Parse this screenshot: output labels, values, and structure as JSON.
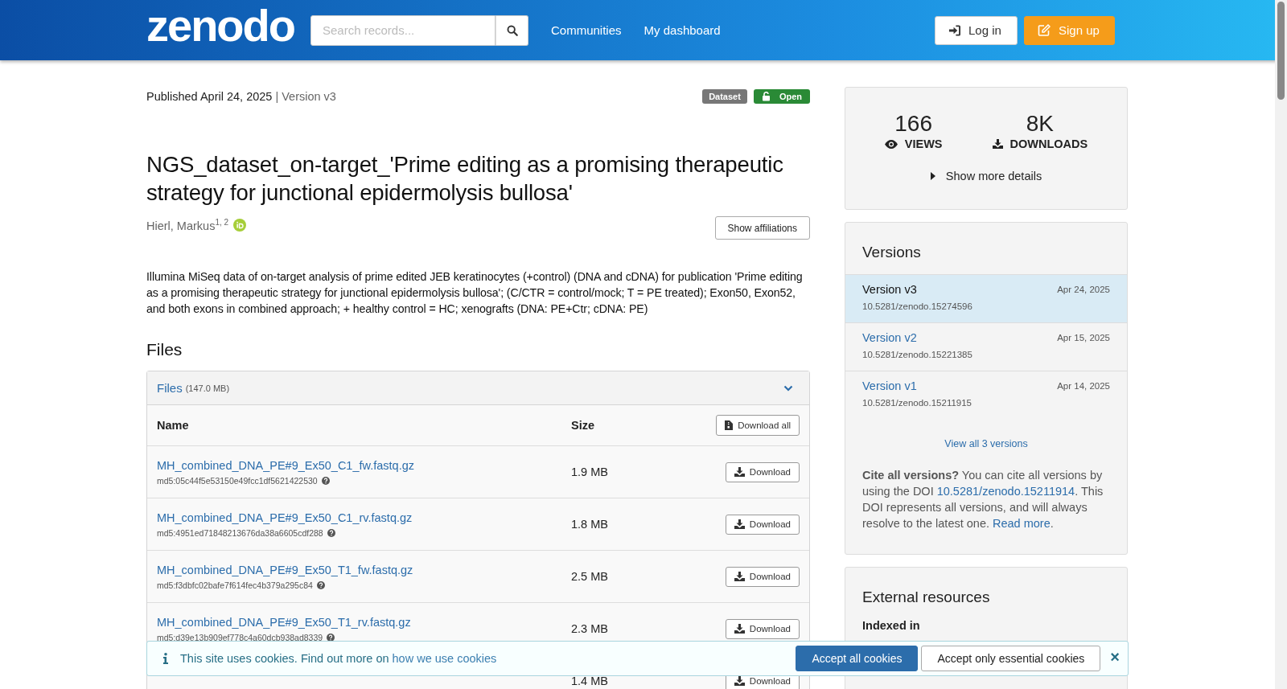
{
  "header": {
    "logo": "zenodo",
    "search": {
      "placeholder": "Search records..."
    },
    "nav": [
      "Communities",
      "My dashboard"
    ],
    "login": "Log in",
    "signup": "Sign up"
  },
  "record": {
    "published": "Published April 24, 2025",
    "version": "| Version v3",
    "badges": [
      {
        "label": "Dataset",
        "kind": "type"
      },
      {
        "label": "Open",
        "kind": "access"
      }
    ],
    "title": "NGS_dataset_on-target_'Prime editing as a promising therapeutic strategy for junctional epidermolysis bullosa'",
    "author": "Hierl, Markus$^{1, 2}$",
    "affiliations_button": "Show affiliations",
    "description": "Illumina MiSeq data of on-target analysis of prime edited JEB keratinocytes (+control) (DNA and cDNA) for publication 'Prime editing as a promising therapeutic strategy for junctional epidermolysis bullosa'; (C/CTR = control/mock; T = PE treated); Exon50, Exon52, and both exons in combined approach; + healthy control = HC; xenografts (DNA: PE+Ctr; cDNA: PE)",
    "files_heading": "Files",
    "files": {
      "title": "Files",
      "total": "(147.0 MB)",
      "expanded": true,
      "columns": [
        "Name",
        "Size"
      ],
      "download_all": "Download all",
      "rows": [
        {
          "name": "MH_combined_DNA_PE#9_Ex50_C1_fw.fastq.gz",
          "md5": "md5:05c44f5e53150e49fcc1df5621422530",
          "size": "1.9 MB",
          "button": "Download"
        },
        {
          "name": "MH_combined_DNA_PE#9_Ex50_C1_rv.fastq.gz",
          "md5": "md5:4951ed71848213676da38a6605cdf288",
          "size": "1.8 MB",
          "button": "Download"
        },
        {
          "name": "MH_combined_DNA_PE#9_Ex50_T1_fw.fastq.gz",
          "md5": "md5:f3dbfc02bafe7f614fec4b379a295c84",
          "size": "2.5 MB",
          "button": "Download"
        },
        {
          "name": "MH_combined_DNA_PE#9_Ex50_T1_rv.fastq.gz",
          "md5": "md5:d39e13b909ef778c4a60dcb938ad8339",
          "size": "2.3 MB",
          "button": "Download"
        },
        {
          "size": "1.4 MB",
          "button": "Download"
        }
      ]
    }
  },
  "sidebar": {
    "stats": [
      {
        "value": "166",
        "label": "VIEWS",
        "kind": "views"
      },
      {
        "value": "8K",
        "label": "DOWNLOADS",
        "kind": "downloads"
      }
    ],
    "more_details": "Show more details",
    "versions": {
      "heading": "Versions",
      "items": [
        {
          "label": "Version v3",
          "date": "Apr 24, 2025",
          "doi": "10.5281/zenodo.15274596",
          "selected": true
        },
        {
          "label": "Version v2",
          "date": "Apr 15, 2025",
          "doi": "10.5281/zenodo.15221385",
          "selected": false
        },
        {
          "label": "Version v1",
          "date": "Apr 14, 2025",
          "doi": "10.5281/zenodo.15211915",
          "selected": false
        }
      ],
      "view_all": "View all 3 versions",
      "cite": {
        "lead": "Cite all versions?",
        "text1": " You can cite all versions by using the DOI ",
        "doi": "10.5281/zenodo.15211914",
        "text2": ". This DOI represents all versions, and will always resolve to the latest one. ",
        "link": "Read more",
        "text3": "."
      }
    },
    "external": {
      "heading": "External resources",
      "subheading": "Indexed in"
    }
  },
  "cookie_banner": {
    "text": "This site uses cookies. Find out more on ",
    "link": "how we use cookies",
    "accept_all": "Accept all cookies",
    "accept_essential": "Accept only essential cookies",
    "close": "×"
  }
}
